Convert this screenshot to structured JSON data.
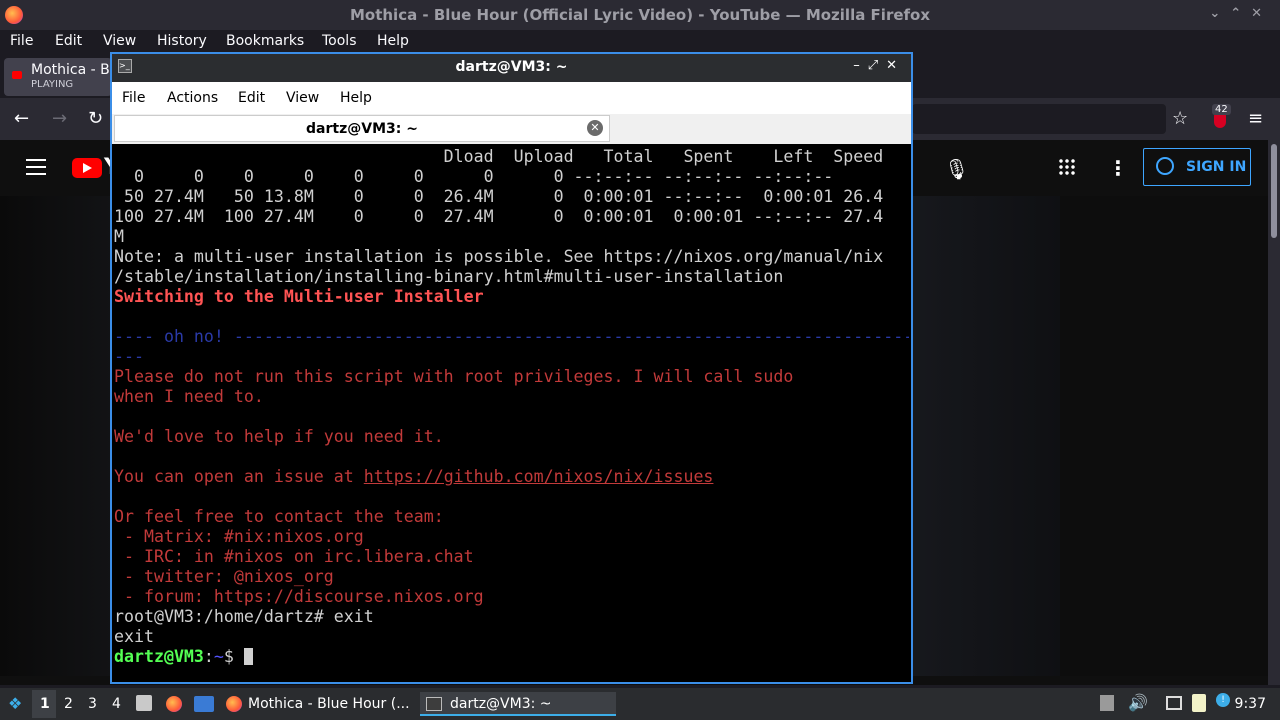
{
  "firefox": {
    "window_title": "Mothica - Blue Hour (Official Lyric Video) - YouTube — Mozilla Firefox",
    "menu": [
      "File",
      "Edit",
      "View",
      "History",
      "Bookmarks",
      "Tools",
      "Help"
    ],
    "tab": {
      "title": "Mothica - Bl",
      "status": "PLAYING"
    },
    "badge_count": "42"
  },
  "youtube": {
    "logo_text": "Y",
    "sign_in_label": "SIGN IN"
  },
  "terminal": {
    "window_title": "dartz@VM3: ~",
    "menu": [
      "File",
      "Actions",
      "Edit",
      "View",
      "Help"
    ],
    "tab_label": "dartz@VM3: ~",
    "lines": {
      "l0": "                                 Dload  Upload   Total   Spent    Left  Speed",
      "l1": "  0     0    0     0    0     0      0      0 --:--:-- --:--:-- --:--:--",
      "l2": " 50 27.4M   50 13.8M    0     0  26.4M      0  0:00:01 --:--:--  0:00:01 26.4",
      "l3": "100 27.4M  100 27.4M    0     0  27.4M      0  0:00:01  0:00:01 --:--:-- 27.4",
      "l4": "M",
      "l5": "Note: a multi-user installation is possible. See https://nixos.org/manual/nix",
      "l6": "/stable/installation/installing-binary.html#multi-user-installation",
      "l7": "Switching to the Multi-user Installer",
      "l9": "---- oh no! --------------------------------------------------------------------",
      "l10": "---",
      "l11": "Please do not run this script with root privileges. I will call sudo",
      "l12": "when I need to.",
      "l14": "We'd love to help if you need it.",
      "l16_pre": "You can open an issue at ",
      "l16_link": "https://github.com/nixos/nix/issues",
      "l18": "Or feel free to contact the team:",
      "l19": " - Matrix: #nix:nixos.org",
      "l20": " - IRC: in #nixos on irc.libera.chat",
      "l21": " - twitter: @nixos_org",
      "l22": " - forum: https://discourse.nixos.org",
      "l23": "root@VM3:/home/dartz# exit",
      "l24": "exit",
      "prompt_user": "dartz@VM3",
      "prompt_sep": ":",
      "prompt_path": "~",
      "prompt_sym": "$ "
    }
  },
  "taskbar": {
    "workspaces": [
      "1",
      "2",
      "3",
      "4"
    ],
    "apps": [
      {
        "label": "Mothica - Blue Hour (..."
      },
      {
        "label": "dartz@VM3: ~"
      }
    ],
    "clock": "9:37"
  }
}
